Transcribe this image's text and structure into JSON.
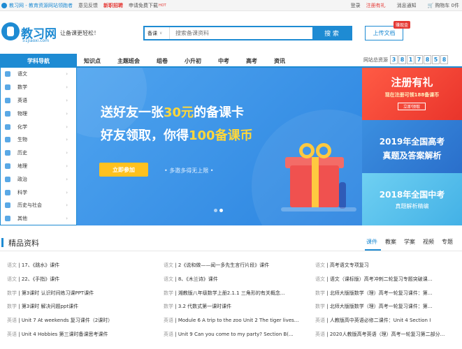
{
  "topbar": {
    "brand": "教习网 - 教育资源网站领跑者",
    "feedback": "意见反馈",
    "jobs": "新职招聘",
    "download_app": "申请免费下载",
    "hot": "HOT",
    "login": "登录",
    "register": "注册有礼",
    "messages": "消息通知",
    "cart": "购物车 0件"
  },
  "header": {
    "logo_text": "教习网",
    "logo_url": "51jiaoxi.com",
    "slogan": "让备课更轻松！",
    "search_category": "备课",
    "search_placeholder": "搜索备课资料",
    "search_button": "搜 索",
    "upload_button": "上传文档",
    "upload_badge": "赚现金"
  },
  "nav": {
    "title": "学科导航",
    "links": [
      "知识点",
      "主题班会",
      "组卷",
      "小升初",
      "中考",
      "高考",
      "资讯"
    ],
    "visits_label": "网站总资源",
    "visits_digits": [
      "3",
      "8",
      "1",
      "7",
      "8",
      "5",
      "8"
    ]
  },
  "sidebar": {
    "items": [
      {
        "label": "语文"
      },
      {
        "label": "数学"
      },
      {
        "label": "英语"
      },
      {
        "label": "物理"
      },
      {
        "label": "化学"
      },
      {
        "label": "生物"
      },
      {
        "label": "历史"
      },
      {
        "label": "地理"
      },
      {
        "label": "政治"
      },
      {
        "label": "科学"
      },
      {
        "label": "历史与社会"
      },
      {
        "label": "其他"
      }
    ]
  },
  "banner": {
    "line1_pre": "送好友一张",
    "line1_hl": "30元",
    "line1_post": "的备课卡",
    "line2_pre": "好友领取，你得",
    "line2_hl": "100备课币",
    "join_button": "立即参加",
    "more_text": "• 多邀多得无上限 •"
  },
  "ads": {
    "ad1_title": "注册有礼",
    "ad1_sub": "现在注册可领188备课币",
    "ad1_btn": "立即领取",
    "ad2_line1": "2019年全国高考",
    "ad2_line2": "真题及答案解析",
    "ad3_line1": "2018年全国中考",
    "ad3_line2": "真题解析精编"
  },
  "section": {
    "title": "精品资料",
    "tabs": [
      "课件",
      "教案",
      "学案",
      "视频",
      "专题"
    ]
  },
  "list": {
    "col1": [
      {
        "sub": "语文",
        "text": "17、《跳水》课件"
      },
      {
        "sub": "语文",
        "text": "22、《手指》课件"
      },
      {
        "sub": "数学",
        "text": "第3课时 认识时间练习课PPT课件"
      },
      {
        "sub": "数学",
        "text": "第3课时 解决问题ppt课件"
      },
      {
        "sub": "英语",
        "text": "Unit 7 At weekends 复习课件（2课时）"
      },
      {
        "sub": "英语",
        "text": "Unit 4 Hobbies 第三课时备课思考课件"
      }
    ],
    "col2": [
      {
        "sub": "语文",
        "text": "2《说和做——闻一多先生言行片段》课件"
      },
      {
        "sub": "语文",
        "text": "8、《木兰诗》课件"
      },
      {
        "sub": "数学",
        "text": "湘教版八年级数学上册2.1.1 三角形的有关概念..."
      },
      {
        "sub": "数学",
        "text": "3.2 代数式第一课时课件"
      },
      {
        "sub": "英语",
        "text": "Module 6 A trip to the zoo Unit 2 The tiger lives..."
      },
      {
        "sub": "英语",
        "text": "Unit 9 Can you come to my party?  Section B(..."
      }
    ],
    "col3": [
      {
        "sub": "语文",
        "text": "高考语文专项复习"
      },
      {
        "sub": "语文",
        "text": "语文（课标版）高考冲刺二轮复习专题突破课..."
      },
      {
        "sub": "数学",
        "text": "北师大版版数学（理）高考一轮复习课件：第..."
      },
      {
        "sub": "数学",
        "text": "北师大版版数学（理）高考一轮复习课件：第..."
      },
      {
        "sub": "英语",
        "text": "人教版高中英语必修二课件：Unit 4 Section Ⅰ"
      },
      {
        "sub": "英语",
        "text": "2020人教版高考英语（理）高考一轮复习第二部分..."
      }
    ]
  }
}
